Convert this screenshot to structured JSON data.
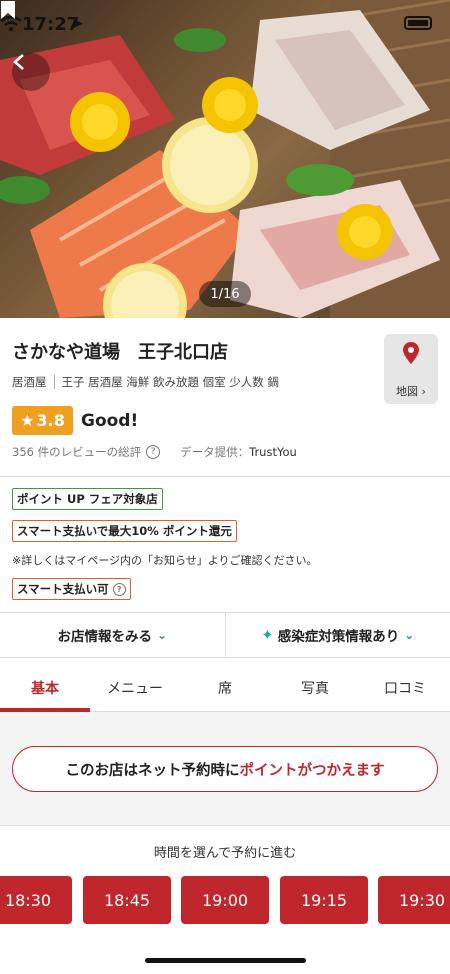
{
  "status_bar": {
    "time": "17:27",
    "location_glyph": "➤"
  },
  "hero": {
    "image_counter": "1/16"
  },
  "shop": {
    "name": "さかなや道場　王子北口店",
    "genre": "居酒屋",
    "tags": "王子 居酒屋 海鮮 飲み放題 個室 少人数 鍋",
    "map_label": "地図"
  },
  "rating": {
    "star": "★",
    "score": "3.8",
    "label": "Good!",
    "review_summary": "356 件のレビューの総評",
    "provider_label": "データ提供：",
    "provider": "TrustYou"
  },
  "badges": {
    "point_up": "ポイント UP フェア対象店",
    "smart_pay_points": "スマート支払いで最大10% ポイント還元",
    "note": "※詳しくはマイページ内の「お知らせ」よりご確認ください。",
    "smart_pay_ok": "スマート支払い可"
  },
  "buttons": {
    "shop_info": "お店情報をみる",
    "covid_info": "感染症対策情報あり"
  },
  "tabs": [
    {
      "label": "基本",
      "active": true
    },
    {
      "label": "メニュー",
      "active": false
    },
    {
      "label": "席",
      "active": false
    },
    {
      "label": "写真",
      "active": false
    },
    {
      "label": "口コミ",
      "active": false
    }
  ],
  "points_banner": {
    "prefix": "このお店はネット予約時に",
    "highlight": "ポイントがつかえます"
  },
  "reservation": {
    "caption": "時間を選んで予約に進む",
    "slots": [
      "18:30",
      "18:45",
      "19:00",
      "19:15",
      "19:30"
    ]
  },
  "colors": {
    "accent": "#c0272d",
    "rating": "#f0a020",
    "green_tag": "#3d9b3d",
    "orange_tag": "#e0602a",
    "chevron": "#3b6fd4"
  }
}
